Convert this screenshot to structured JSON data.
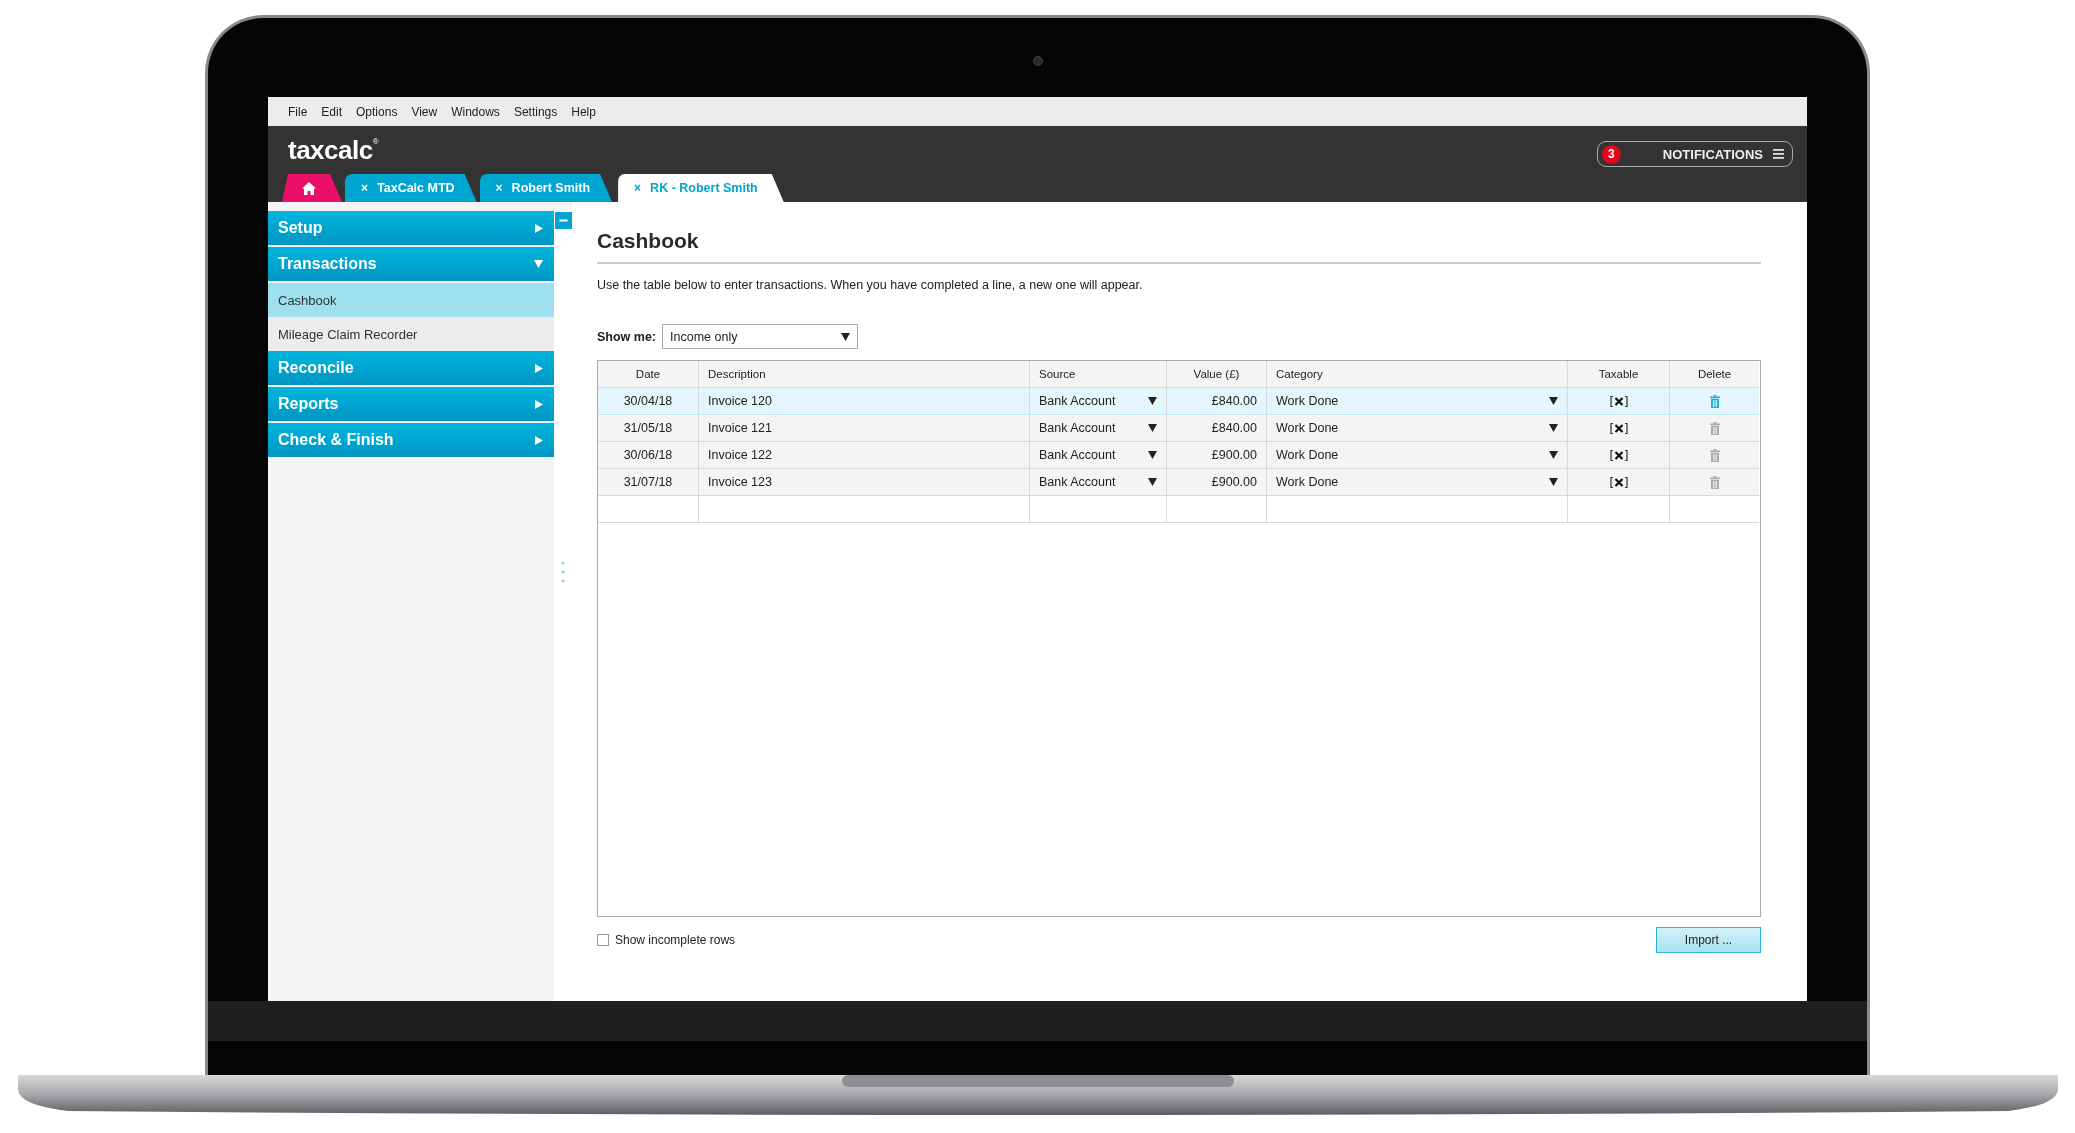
{
  "menu": [
    "File",
    "Edit",
    "Options",
    "View",
    "Windows",
    "Settings",
    "Help"
  ],
  "header": {
    "logo": "taxcalc",
    "logo_mark": "®",
    "notifications": {
      "count": "3",
      "label": "NOTIFICATIONS"
    }
  },
  "tabs": [
    {
      "kind": "home",
      "selected": false
    },
    {
      "kind": "doc",
      "close": "×",
      "label": "TaxCalc MTD",
      "selected": false
    },
    {
      "kind": "doc",
      "close": "×",
      "label": "Robert Smith",
      "selected": false
    },
    {
      "kind": "doc",
      "close": "×",
      "label": "RK - Robert Smith",
      "selected": true
    }
  ],
  "sidebar": {
    "items": [
      {
        "label": "Setup",
        "expanded": false
      },
      {
        "label": "Transactions",
        "expanded": true,
        "children": [
          {
            "label": "Cashbook",
            "selected": true
          },
          {
            "label": "Mileage Claim Recorder",
            "selected": false
          }
        ]
      },
      {
        "label": "Reconcile",
        "expanded": false
      },
      {
        "label": "Reports",
        "expanded": false
      },
      {
        "label": "Check & Finish",
        "expanded": false
      }
    ]
  },
  "content": {
    "title": "Cashbook",
    "intro": "Use the table below to enter transactions. When you have completed a line, a new one will appear.",
    "filter": {
      "label": "Show me:",
      "value": "Income only"
    },
    "table": {
      "columns": [
        "Date",
        "Description",
        "Source",
        "Value (£)",
        "Category",
        "Taxable",
        "Delete"
      ],
      "rows": [
        {
          "date": "30/04/18",
          "description": "Invoice 120",
          "source": "Bank Account",
          "value": "£840.00",
          "category": "Work Done",
          "taxable": true,
          "selected": true
        },
        {
          "date": "31/05/18",
          "description": "Invoice 121",
          "source": "Bank Account",
          "value": "£840.00",
          "category": "Work Done",
          "taxable": true,
          "selected": false
        },
        {
          "date": "30/06/18",
          "description": "Invoice 122",
          "source": "Bank Account",
          "value": "£900.00",
          "category": "Work Done",
          "taxable": true,
          "selected": false
        },
        {
          "date": "31/07/18",
          "description": "Invoice 123",
          "source": "Bank Account",
          "value": "£900.00",
          "category": "Work Done",
          "taxable": true,
          "selected": false
        }
      ]
    },
    "incomplete_rows": {
      "label": "Show incomplete rows",
      "checked": false
    },
    "import_button": "Import ..."
  }
}
